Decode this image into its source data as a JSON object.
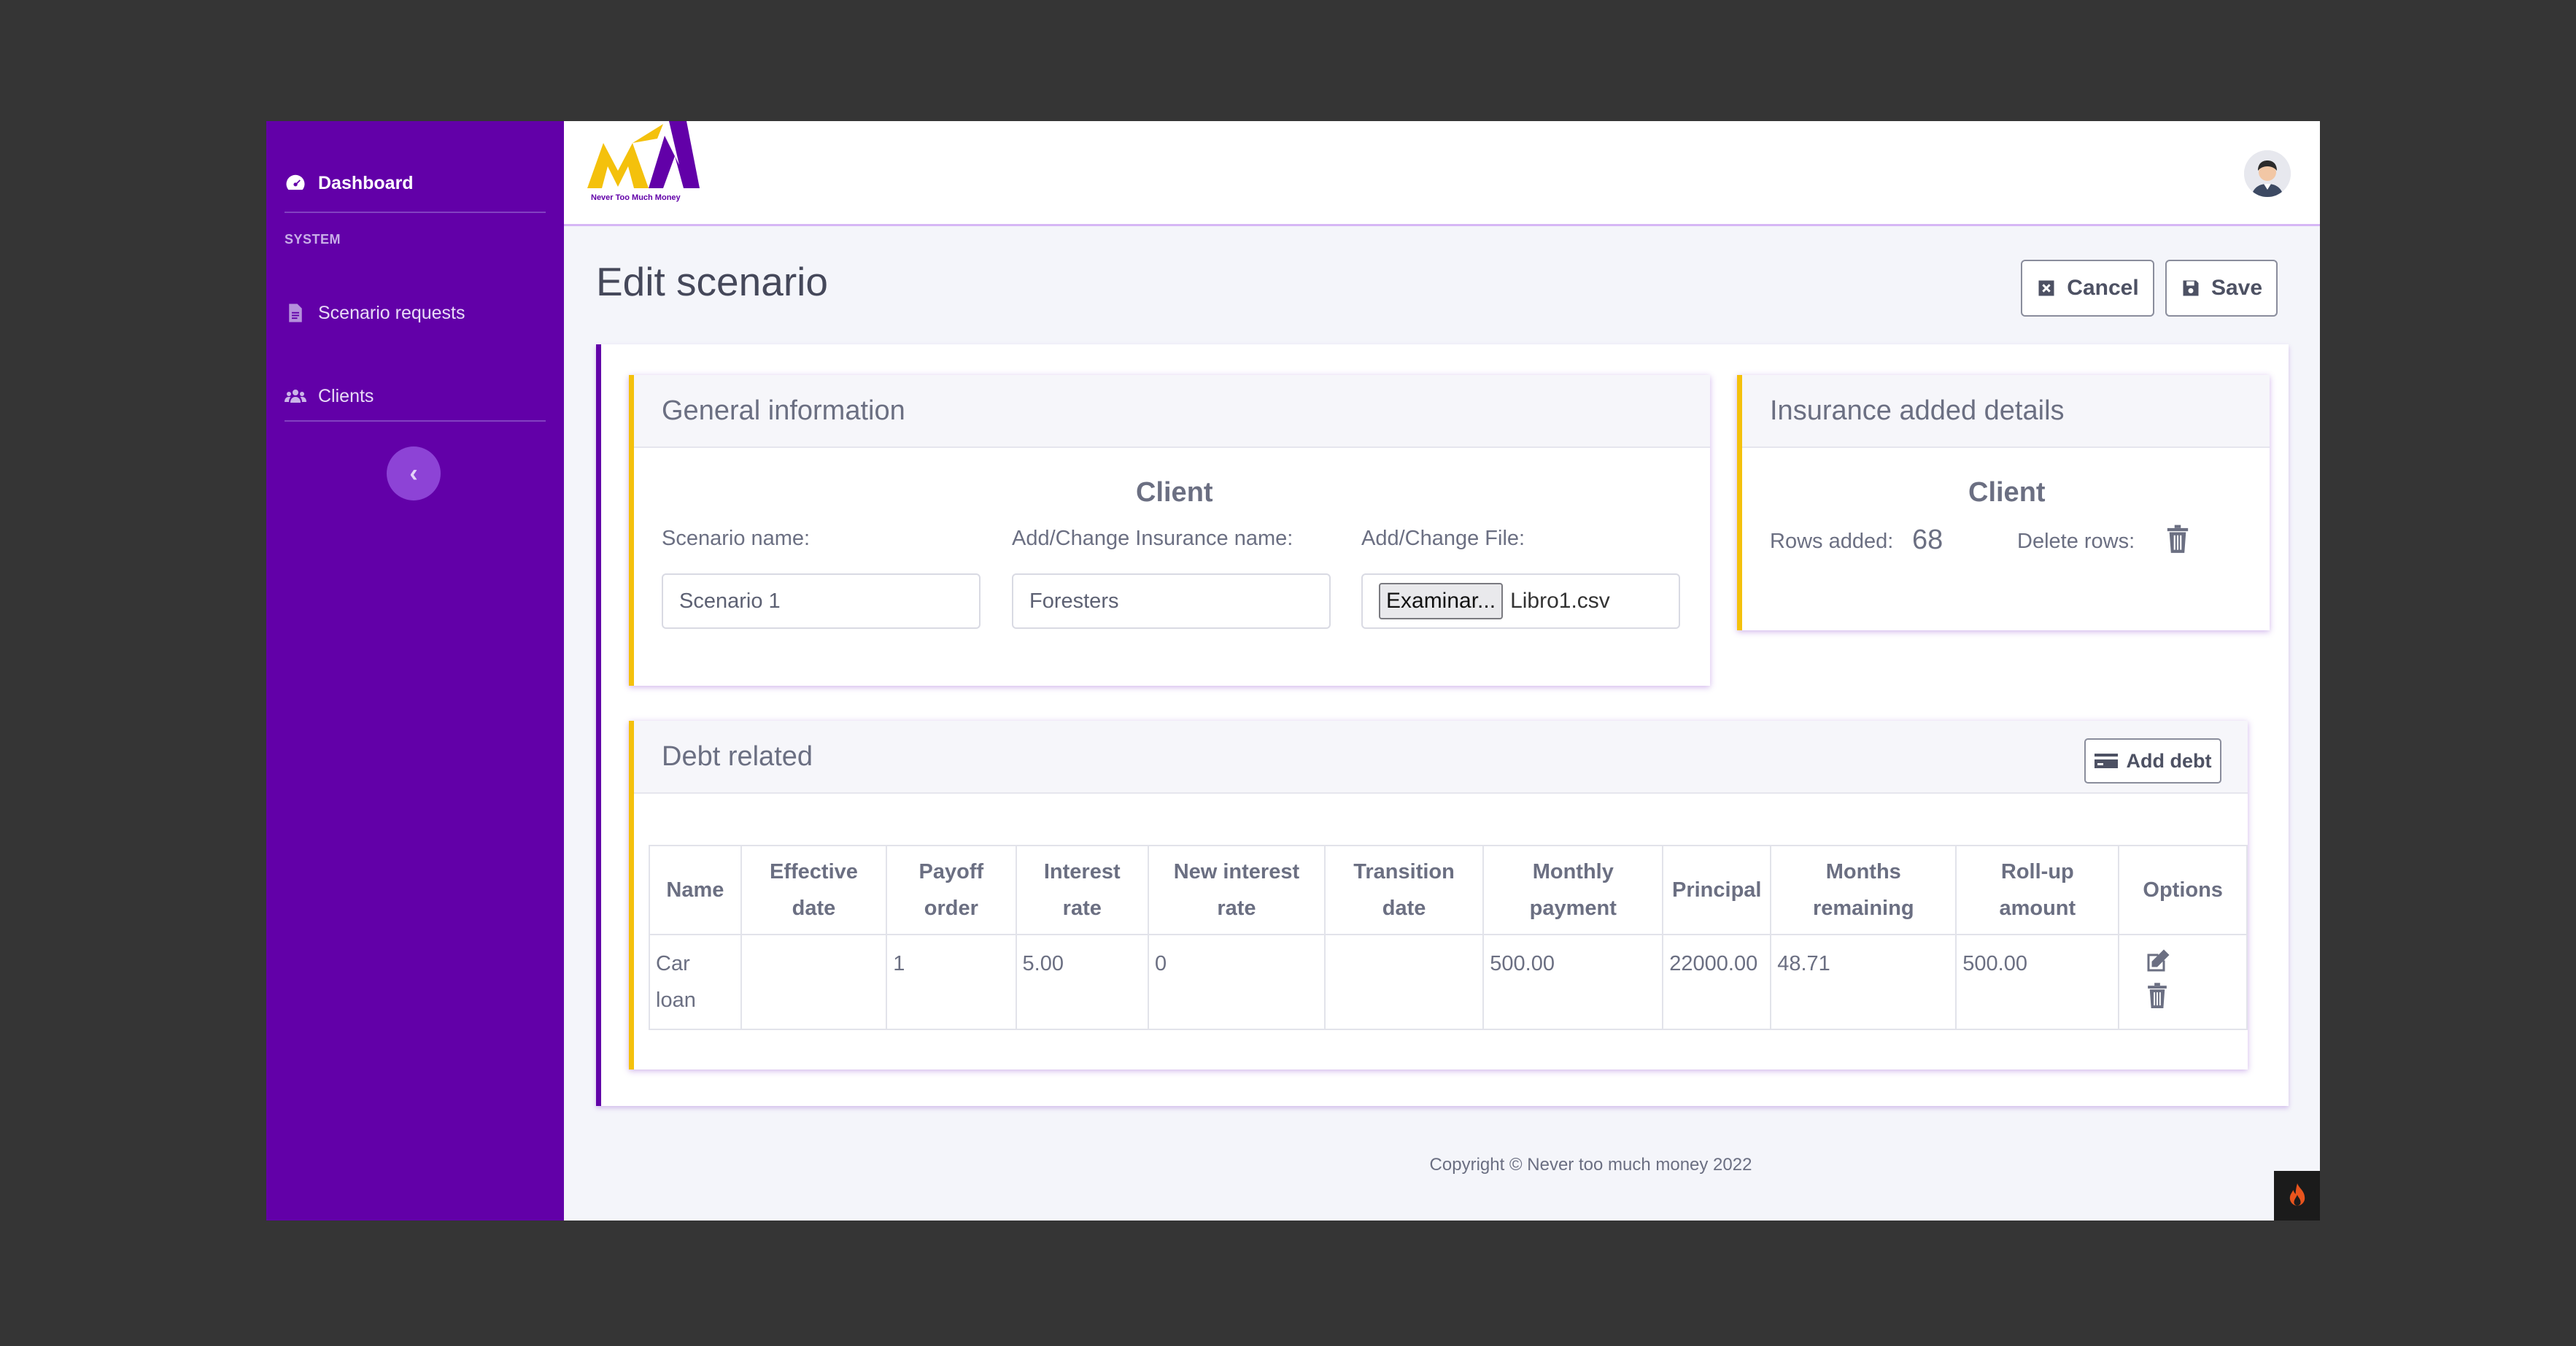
{
  "sidebar": {
    "dashboard": "Dashboard",
    "section": "SYSTEM",
    "items": [
      {
        "label": "Scenario requests",
        "icon": "file-icon"
      },
      {
        "label": "Clients",
        "icon": "users-icon"
      }
    ],
    "collapse": "‹"
  },
  "topbar": {
    "logo_text": "Never Too Much Money"
  },
  "page": {
    "title": "Edit scenario",
    "cancel": "Cancel",
    "save": "Save"
  },
  "general": {
    "title": "General information",
    "client_heading": "Client",
    "scenario_label": "Scenario name:",
    "scenario_value": "Scenario 1",
    "insurance_label": "Add/Change Insurance name:",
    "insurance_value": "Foresters",
    "file_label": "Add/Change File:",
    "file_button": "Examinar...",
    "file_name": "Libro1.csv"
  },
  "insurance": {
    "title": "Insurance added details",
    "client_heading": "Client",
    "rows_label": "Rows added:",
    "rows_value": "68",
    "delete_label": "Delete rows:"
  },
  "debt": {
    "title": "Debt related",
    "add_button": "Add debt",
    "columns": [
      "Name",
      "Effective date",
      "Payoff order",
      "Interest rate",
      "New interest rate",
      "Transition date",
      "Monthly payment",
      "Principal",
      "Months remaining",
      "Roll-up amount",
      "Options"
    ],
    "rows": [
      [
        "Car loan",
        "",
        "1",
        "5.00",
        "0",
        "",
        "500.00",
        "22000.00",
        "48.71",
        "500.00"
      ]
    ]
  },
  "footer": "Copyright © Never too much money 2022",
  "colors": {
    "sidebar": "#6200a8",
    "accent": "#f4c10c",
    "background": "#f4f5fa"
  }
}
